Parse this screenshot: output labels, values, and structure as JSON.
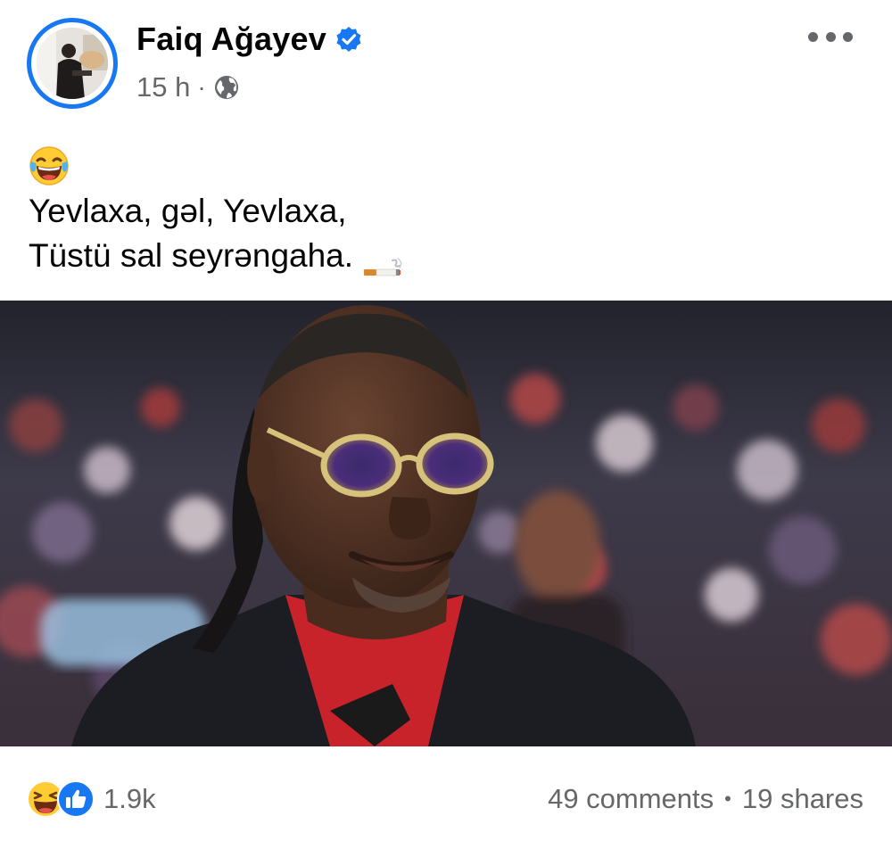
{
  "post": {
    "author": {
      "name": "Faiq Ağayev",
      "verified": true
    },
    "time": "15 h",
    "separator": "·",
    "audience_icon": "globe-icon",
    "menu_icon": "more-options-icon",
    "text": {
      "leading_emoji": "face-with-tears-of-joy",
      "lines": [
        "Yevlaxa, gəl, Yevlaxa,",
        "Tüstü sal seyrəngaha."
      ],
      "trailing_emoji": "cigarette"
    },
    "photo_icon": "post-photo"
  },
  "engagement": {
    "reaction_icons": [
      "haha-reaction-icon",
      "like-reaction-icon"
    ],
    "reaction_count": "1.9k",
    "comments": "49 comments",
    "dot": "•",
    "shares": "19 shares"
  },
  "colors": {
    "brand_blue": "#1877f2",
    "secondary_text": "#65676b",
    "primary_text": "#050505"
  }
}
